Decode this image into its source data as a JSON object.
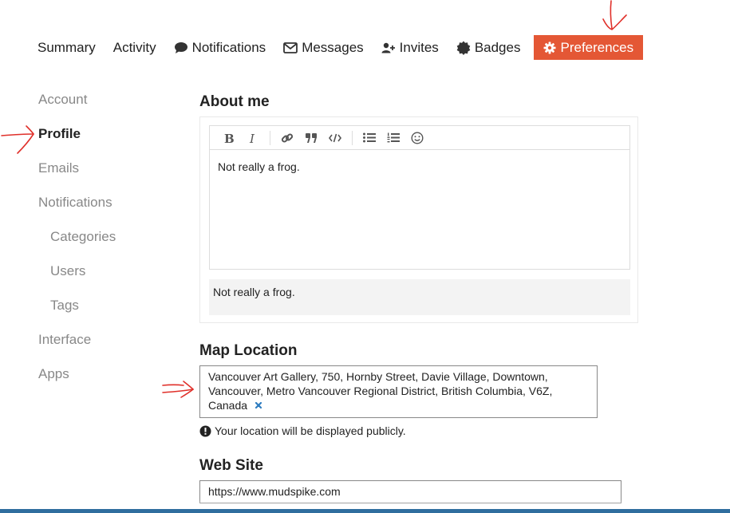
{
  "nav": {
    "summary": "Summary",
    "activity": "Activity",
    "notifications": "Notifications",
    "messages": "Messages",
    "invites": "Invites",
    "badges": "Badges",
    "preferences": "Preferences"
  },
  "sidebar": {
    "account": "Account",
    "profile": "Profile",
    "emails": "Emails",
    "notifications": "Notifications",
    "categories": "Categories",
    "users": "Users",
    "tags": "Tags",
    "interface": "Interface",
    "apps": "Apps"
  },
  "about": {
    "title": "About me",
    "text": "Not really a frog.",
    "preview": "Not really a frog."
  },
  "map": {
    "title": "Map Location",
    "value": "Vancouver Art Gallery, 750, Hornby Street, Davie Village, Downtown, Vancouver, Metro Vancouver Regional District, British Columbia, V6Z, Canada",
    "notice": "Your location will be displayed publicly."
  },
  "website": {
    "title": "Web Site",
    "value": "https://www.mudspike.com"
  },
  "colors": {
    "accent": "#e45735",
    "annotation": "#e0302a",
    "muted_text": "#888888"
  }
}
